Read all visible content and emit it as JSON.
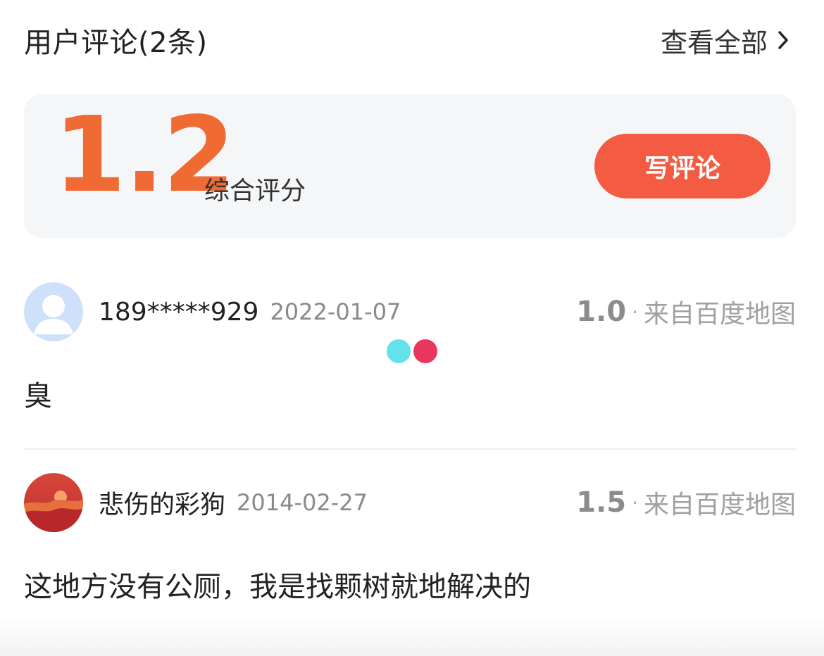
{
  "header": {
    "title": "用户评论(2条)",
    "view_all": "查看全部"
  },
  "rating": {
    "score": "1.2",
    "label": "综合评分",
    "write_button": "写评论"
  },
  "reviews": [
    {
      "author": "189*****929",
      "date": "2022-01-07",
      "score": "1.0",
      "dot": "·",
      "source": "来自百度地图",
      "text": "臭"
    },
    {
      "author": "悲伤的彩狗",
      "date": "2014-02-27",
      "score": "1.5",
      "dot": "·",
      "source": "来自百度地图",
      "text": "这地方没有公厕，我是找颗树就地解决的"
    }
  ],
  "colors": {
    "accent": "#f06a33",
    "button": "#f35c42",
    "loader_left": "#62e3ec",
    "loader_right": "#e8365c"
  },
  "icons": {
    "view_all": "chevron-right-icon",
    "avatar_default": "default-avatar-icon",
    "avatar_sunset": "sunset-avatar-icon"
  }
}
